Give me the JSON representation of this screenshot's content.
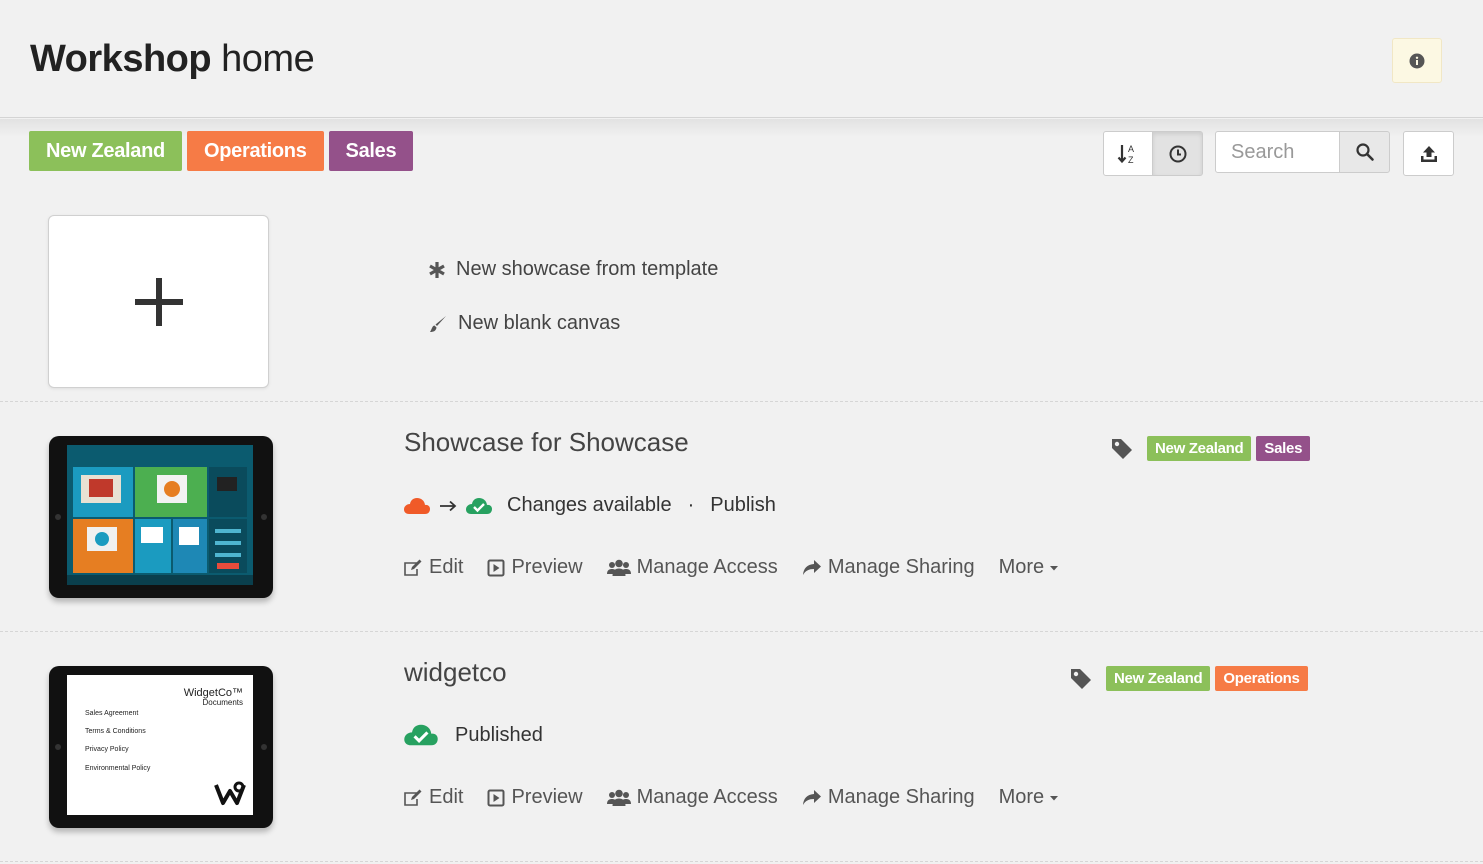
{
  "header": {
    "title_bold": "Workshop",
    "title_light": "home",
    "info_icon": "info-circle-icon"
  },
  "filters": [
    {
      "label": "New Zealand",
      "color": "#8cc05a"
    },
    {
      "label": "Operations",
      "color": "#f67b46"
    },
    {
      "label": "Sales",
      "color": "#94518a"
    }
  ],
  "toolbar": {
    "sort_alpha_icon": "sort-alpha-icon",
    "sort_recent_icon": "clock-icon",
    "search_placeholder": "Search",
    "search_icon": "search-icon",
    "upload_icon": "upload-icon"
  },
  "new_section": {
    "options": [
      {
        "label": "New showcase from template",
        "icon": "asterisk-icon"
      },
      {
        "label": "New blank canvas",
        "icon": "brush-icon"
      }
    ]
  },
  "items": [
    {
      "title": "Showcase for Showcase",
      "status": "Changes available",
      "status_separator": "·",
      "status_action": "Publish",
      "tags": [
        {
          "label": "New Zealand",
          "color": "#8cc05a"
        },
        {
          "label": "Sales",
          "color": "#94518a"
        }
      ],
      "actions": [
        "Edit",
        "Preview",
        "Manage Access",
        "Manage Sharing",
        "More"
      ]
    },
    {
      "title": "widgetco",
      "status": "Published",
      "tags": [
        {
          "label": "New Zealand",
          "color": "#8cc05a"
        },
        {
          "label": "Operations",
          "color": "#f67b46"
        }
      ],
      "actions": [
        "Edit",
        "Preview",
        "Manage Access",
        "Manage Sharing",
        "More"
      ],
      "thumbnail": {
        "brand": "WidgetCo™",
        "subtitle": "Documents",
        "lines": [
          "Sales Agreement",
          "Terms & Conditions",
          "Privacy Policy",
          "Environmental Policy"
        ]
      }
    }
  ]
}
